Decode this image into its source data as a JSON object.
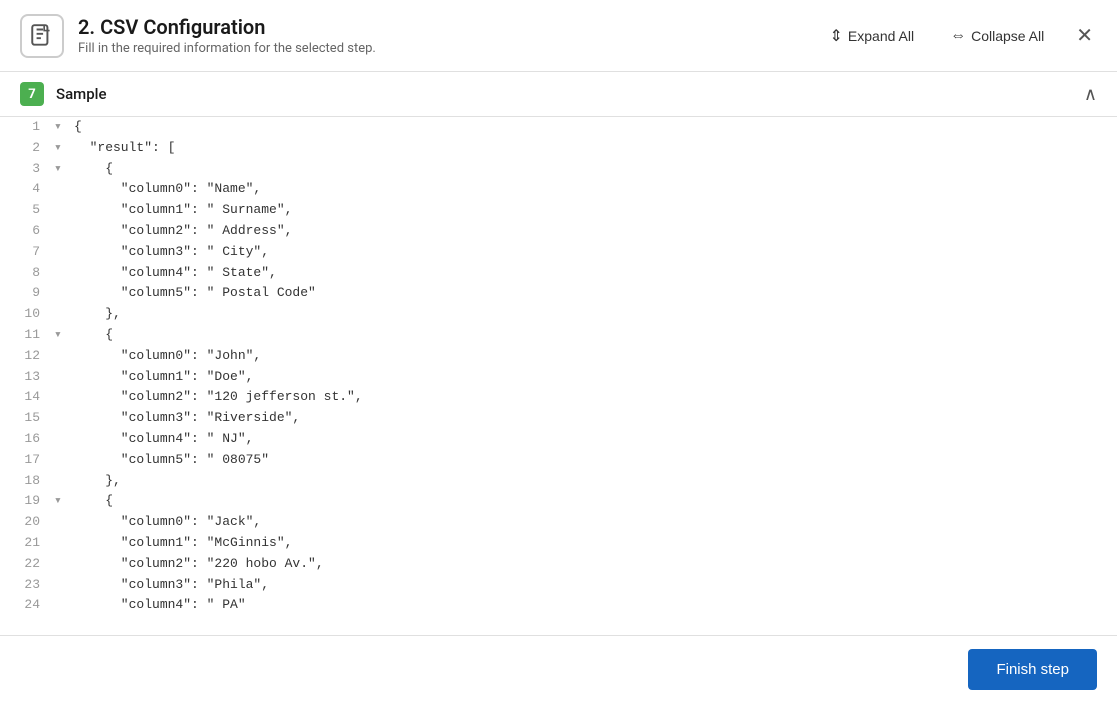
{
  "header": {
    "title": "2. CSV Configuration",
    "subtitle": "Fill in the required information for the selected step.",
    "expand_all_label": "Expand All",
    "collapse_all_label": "Collapse All",
    "expand_icon": "⇕",
    "collapse_icon": "⇔",
    "close_icon": "✕"
  },
  "section": {
    "badge_number": "7",
    "title": "Sample",
    "collapse_icon": "∧"
  },
  "footer": {
    "finish_label": "Finish step"
  },
  "code_lines": [
    {
      "num": "1",
      "arrow": "▾",
      "content": "{"
    },
    {
      "num": "2",
      "arrow": "▾",
      "content": "  \"result\": ["
    },
    {
      "num": "3",
      "arrow": "▾",
      "content": "    {"
    },
    {
      "num": "4",
      "arrow": "",
      "content": "      \"column0\": \"Name\","
    },
    {
      "num": "5",
      "arrow": "",
      "content": "      \"column1\": \" Surname\","
    },
    {
      "num": "6",
      "arrow": "",
      "content": "      \"column2\": \" Address\","
    },
    {
      "num": "7",
      "arrow": "",
      "content": "      \"column3\": \" City\","
    },
    {
      "num": "8",
      "arrow": "",
      "content": "      \"column4\": \" State\","
    },
    {
      "num": "9",
      "arrow": "",
      "content": "      \"column5\": \" Postal Code\""
    },
    {
      "num": "10",
      "arrow": "",
      "content": "    },"
    },
    {
      "num": "11",
      "arrow": "▾",
      "content": "    {"
    },
    {
      "num": "12",
      "arrow": "",
      "content": "      \"column0\": \"John\","
    },
    {
      "num": "13",
      "arrow": "",
      "content": "      \"column1\": \"Doe\","
    },
    {
      "num": "14",
      "arrow": "",
      "content": "      \"column2\": \"120 jefferson st.\","
    },
    {
      "num": "15",
      "arrow": "",
      "content": "      \"column3\": \"Riverside\","
    },
    {
      "num": "16",
      "arrow": "",
      "content": "      \"column4\": \" NJ\","
    },
    {
      "num": "17",
      "arrow": "",
      "content": "      \"column5\": \" 08075\""
    },
    {
      "num": "18",
      "arrow": "",
      "content": "    },"
    },
    {
      "num": "19",
      "arrow": "▾",
      "content": "    {"
    },
    {
      "num": "20",
      "arrow": "",
      "content": "      \"column0\": \"Jack\","
    },
    {
      "num": "21",
      "arrow": "",
      "content": "      \"column1\": \"McGinnis\","
    },
    {
      "num": "22",
      "arrow": "",
      "content": "      \"column2\": \"220 hobo Av.\","
    },
    {
      "num": "23",
      "arrow": "",
      "content": "      \"column3\": \"Phila\","
    },
    {
      "num": "24",
      "arrow": "",
      "content": "      \"column4\": \" PA\""
    }
  ]
}
